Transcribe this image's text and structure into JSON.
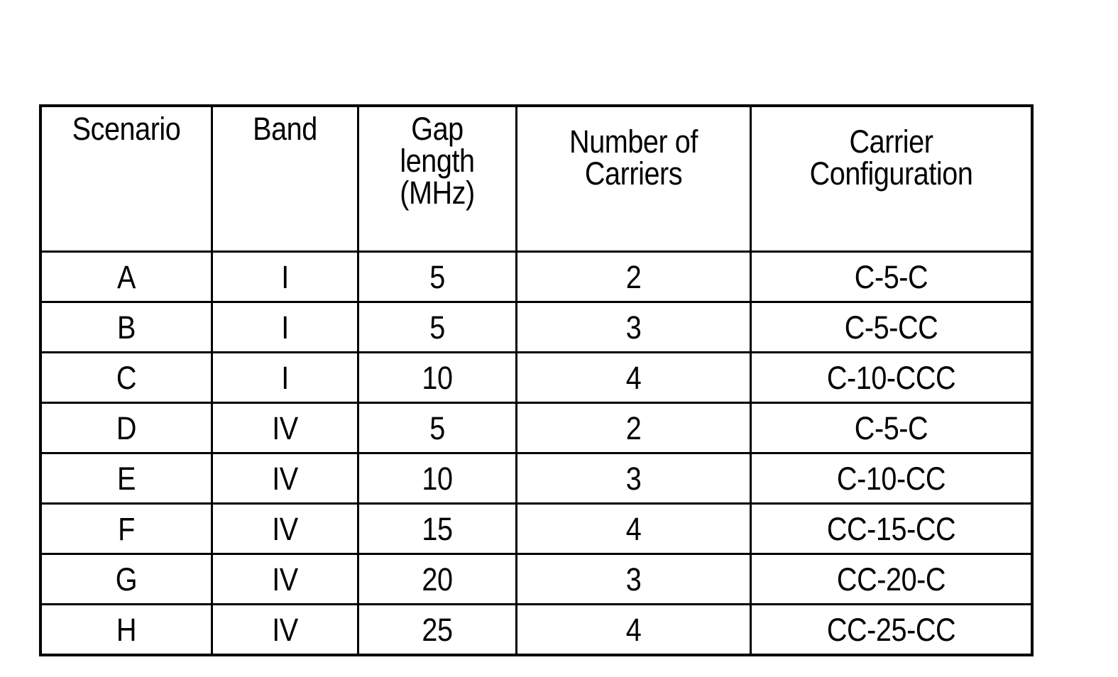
{
  "document": {
    "kind": "table-figure",
    "background_color": "#ffffff",
    "line_color": "#000000",
    "text_color": "#000000"
  },
  "table": {
    "columns": [
      {
        "key": "scenario",
        "header": "Scenario"
      },
      {
        "key": "band",
        "header": "Band"
      },
      {
        "key": "gap_length_mhz",
        "header": "Gap\nlength\n(MHz)"
      },
      {
        "key": "number_of_carriers",
        "header": "Number of\nCarriers"
      },
      {
        "key": "carrier_configuration",
        "header": "Carrier\nConfiguration"
      }
    ],
    "rows": [
      {
        "scenario": "A",
        "band": "I",
        "gap_length_mhz": "5",
        "number_of_carriers": "2",
        "carrier_configuration": "C-5-C"
      },
      {
        "scenario": "B",
        "band": "I",
        "gap_length_mhz": "5",
        "number_of_carriers": "3",
        "carrier_configuration": "C-5-CC"
      },
      {
        "scenario": "C",
        "band": "I",
        "gap_length_mhz": "10",
        "number_of_carriers": "4",
        "carrier_configuration": "C-10-CCC"
      },
      {
        "scenario": "D",
        "band": "IV",
        "gap_length_mhz": "5",
        "number_of_carriers": "2",
        "carrier_configuration": "C-5-C"
      },
      {
        "scenario": "E",
        "band": "IV",
        "gap_length_mhz": "10",
        "number_of_carriers": "3",
        "carrier_configuration": "C-10-CC"
      },
      {
        "scenario": "F",
        "band": "IV",
        "gap_length_mhz": "15",
        "number_of_carriers": "4",
        "carrier_configuration": "CC-15-CC"
      },
      {
        "scenario": "G",
        "band": "IV",
        "gap_length_mhz": "20",
        "number_of_carriers": "3",
        "carrier_configuration": "CC-20-C"
      },
      {
        "scenario": "H",
        "band": "IV",
        "gap_length_mhz": "25",
        "number_of_carriers": "4",
        "carrier_configuration": "CC-25-CC"
      }
    ]
  }
}
